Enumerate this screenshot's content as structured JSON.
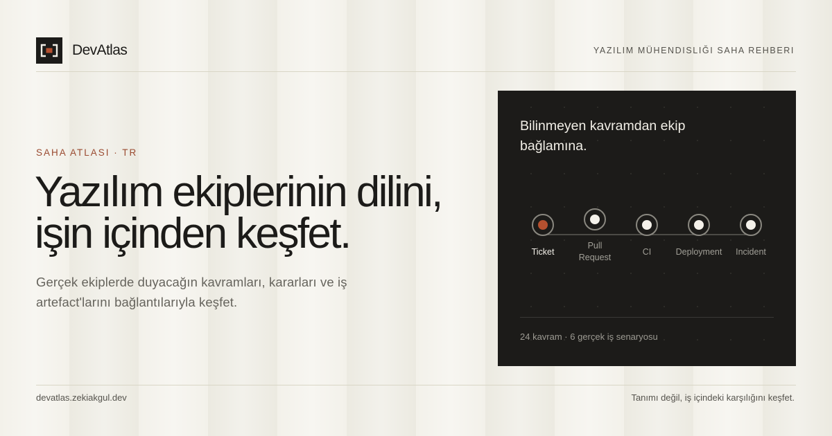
{
  "header": {
    "brand": "DevAtlas",
    "logo_icon": "bracket-square-icon",
    "tagline": "YAZILIM MÜHENDISLIĞI SAHA REHBERI"
  },
  "hero": {
    "eyebrow": "SAHA ATLASI · TR",
    "headline_line1": "Yazılım ekiplerinin dilini,",
    "headline_line2": "işin içinden keşfet.",
    "subtitle_line1": "Gerçek ekiplerde duyacağın kavramları, kararları ve iş",
    "subtitle_line2": "artefact'larını bağlantılarıyla keşfet."
  },
  "panel": {
    "title_line1": "Bilinmeyen kavramdan ekip",
    "title_line2": "bağlamına.",
    "steps": [
      {
        "line1": "Ticket",
        "line2": "",
        "active": true
      },
      {
        "line1": "Pull",
        "line2": "Request",
        "active": false
      },
      {
        "line1": "CI",
        "line2": "",
        "active": false
      },
      {
        "line1": "Deployment",
        "line2": "",
        "active": false
      },
      {
        "line1": "Incident",
        "line2": "",
        "active": false
      }
    ],
    "stats": "24 kavram · 6 gerçek iş senaryosu"
  },
  "footer": {
    "url": "devatlas.zekiakgul.dev",
    "tagline": "Tanımı değil, iş içindeki karşılığını keşfet."
  },
  "colors": {
    "background": "#f3f1ea",
    "ink": "#1c1b19",
    "accent": "#b5502f",
    "eyebrow": "#9a4a30",
    "panel": "#1c1b19"
  }
}
